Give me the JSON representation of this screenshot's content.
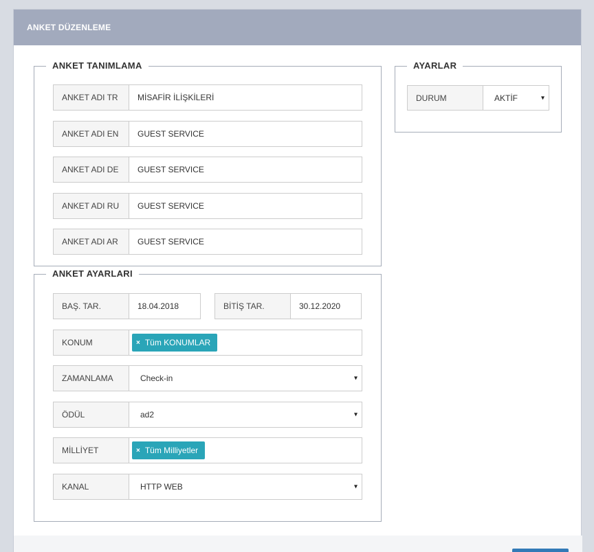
{
  "header": {
    "title": "ANKET DÜZENLEME"
  },
  "definition": {
    "legend": "ANKET TANIMLAMA",
    "fields": [
      {
        "label": "ANKET ADI TR",
        "value": "MİSAFİR İLİŞKİLERİ"
      },
      {
        "label": "ANKET ADI EN",
        "value": "GUEST SERVICE"
      },
      {
        "label": "ANKET ADI DE",
        "value": "GUEST SERVICE"
      },
      {
        "label": "ANKET ADI RU",
        "value": "GUEST SERVICE"
      },
      {
        "label": "ANKET ADI AR",
        "value": "GUEST SERVICE"
      }
    ]
  },
  "survey_settings": {
    "legend": "ANKET AYARLARI",
    "start_label": "BAŞ. TAR.",
    "start_value": "18.04.2018",
    "end_label": "BİTİŞ TAR.",
    "end_value": "30.12.2020",
    "location_label": "KONUM",
    "location_tag": "Tüm KONUMLAR",
    "timing_label": "ZAMANLAMA",
    "timing_value": "Check-in",
    "reward_label": "ÖDÜL",
    "reward_value": "ad2",
    "nationality_label": "MİLLİYET",
    "nationality_tag": "Tüm Milliyetler",
    "channel_label": "KANAL",
    "channel_value": "HTTP WEB",
    "tag_remove_glyph": "×",
    "dropdown_glyph": "▾"
  },
  "settings": {
    "legend": "AYARLAR",
    "status_label": "DURUM",
    "status_value": "AKTİF"
  },
  "colors": {
    "header_bg": "#a2aabd",
    "tag_bg": "#2aa5b8",
    "button_bg": "#337ab7"
  }
}
